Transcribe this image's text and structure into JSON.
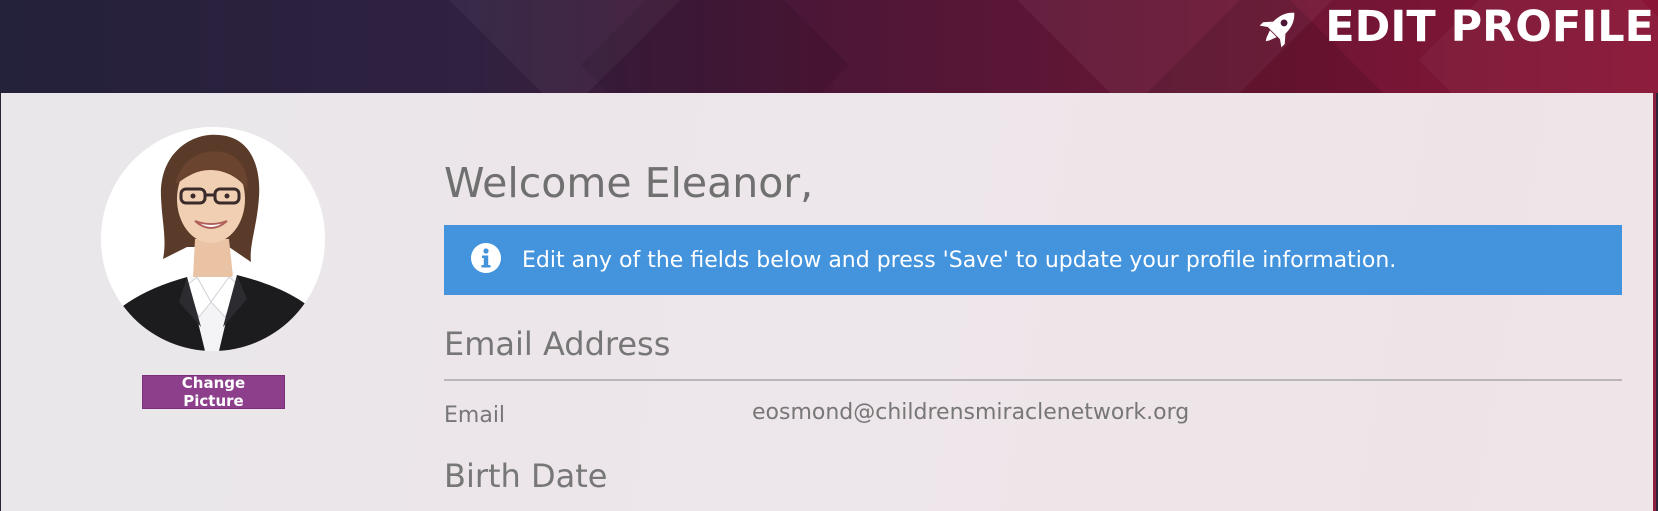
{
  "header": {
    "title": "EDIT PROFILE",
    "icon": "rocket-icon"
  },
  "profile": {
    "change_picture_label": "Change Picture"
  },
  "main": {
    "welcome": "Welcome Eleanor,",
    "info_message": "Edit any of the fields below and press 'Save' to update your profile information.",
    "sections": {
      "email": {
        "heading": "Email Address",
        "label": "Email",
        "value": "eosmond@childrensmiraclenetwork.org"
      },
      "birth_date": {
        "heading": "Birth Date"
      }
    }
  },
  "colors": {
    "banner": "#4393dd",
    "button": "#8e3f8b",
    "text": "#707070"
  }
}
